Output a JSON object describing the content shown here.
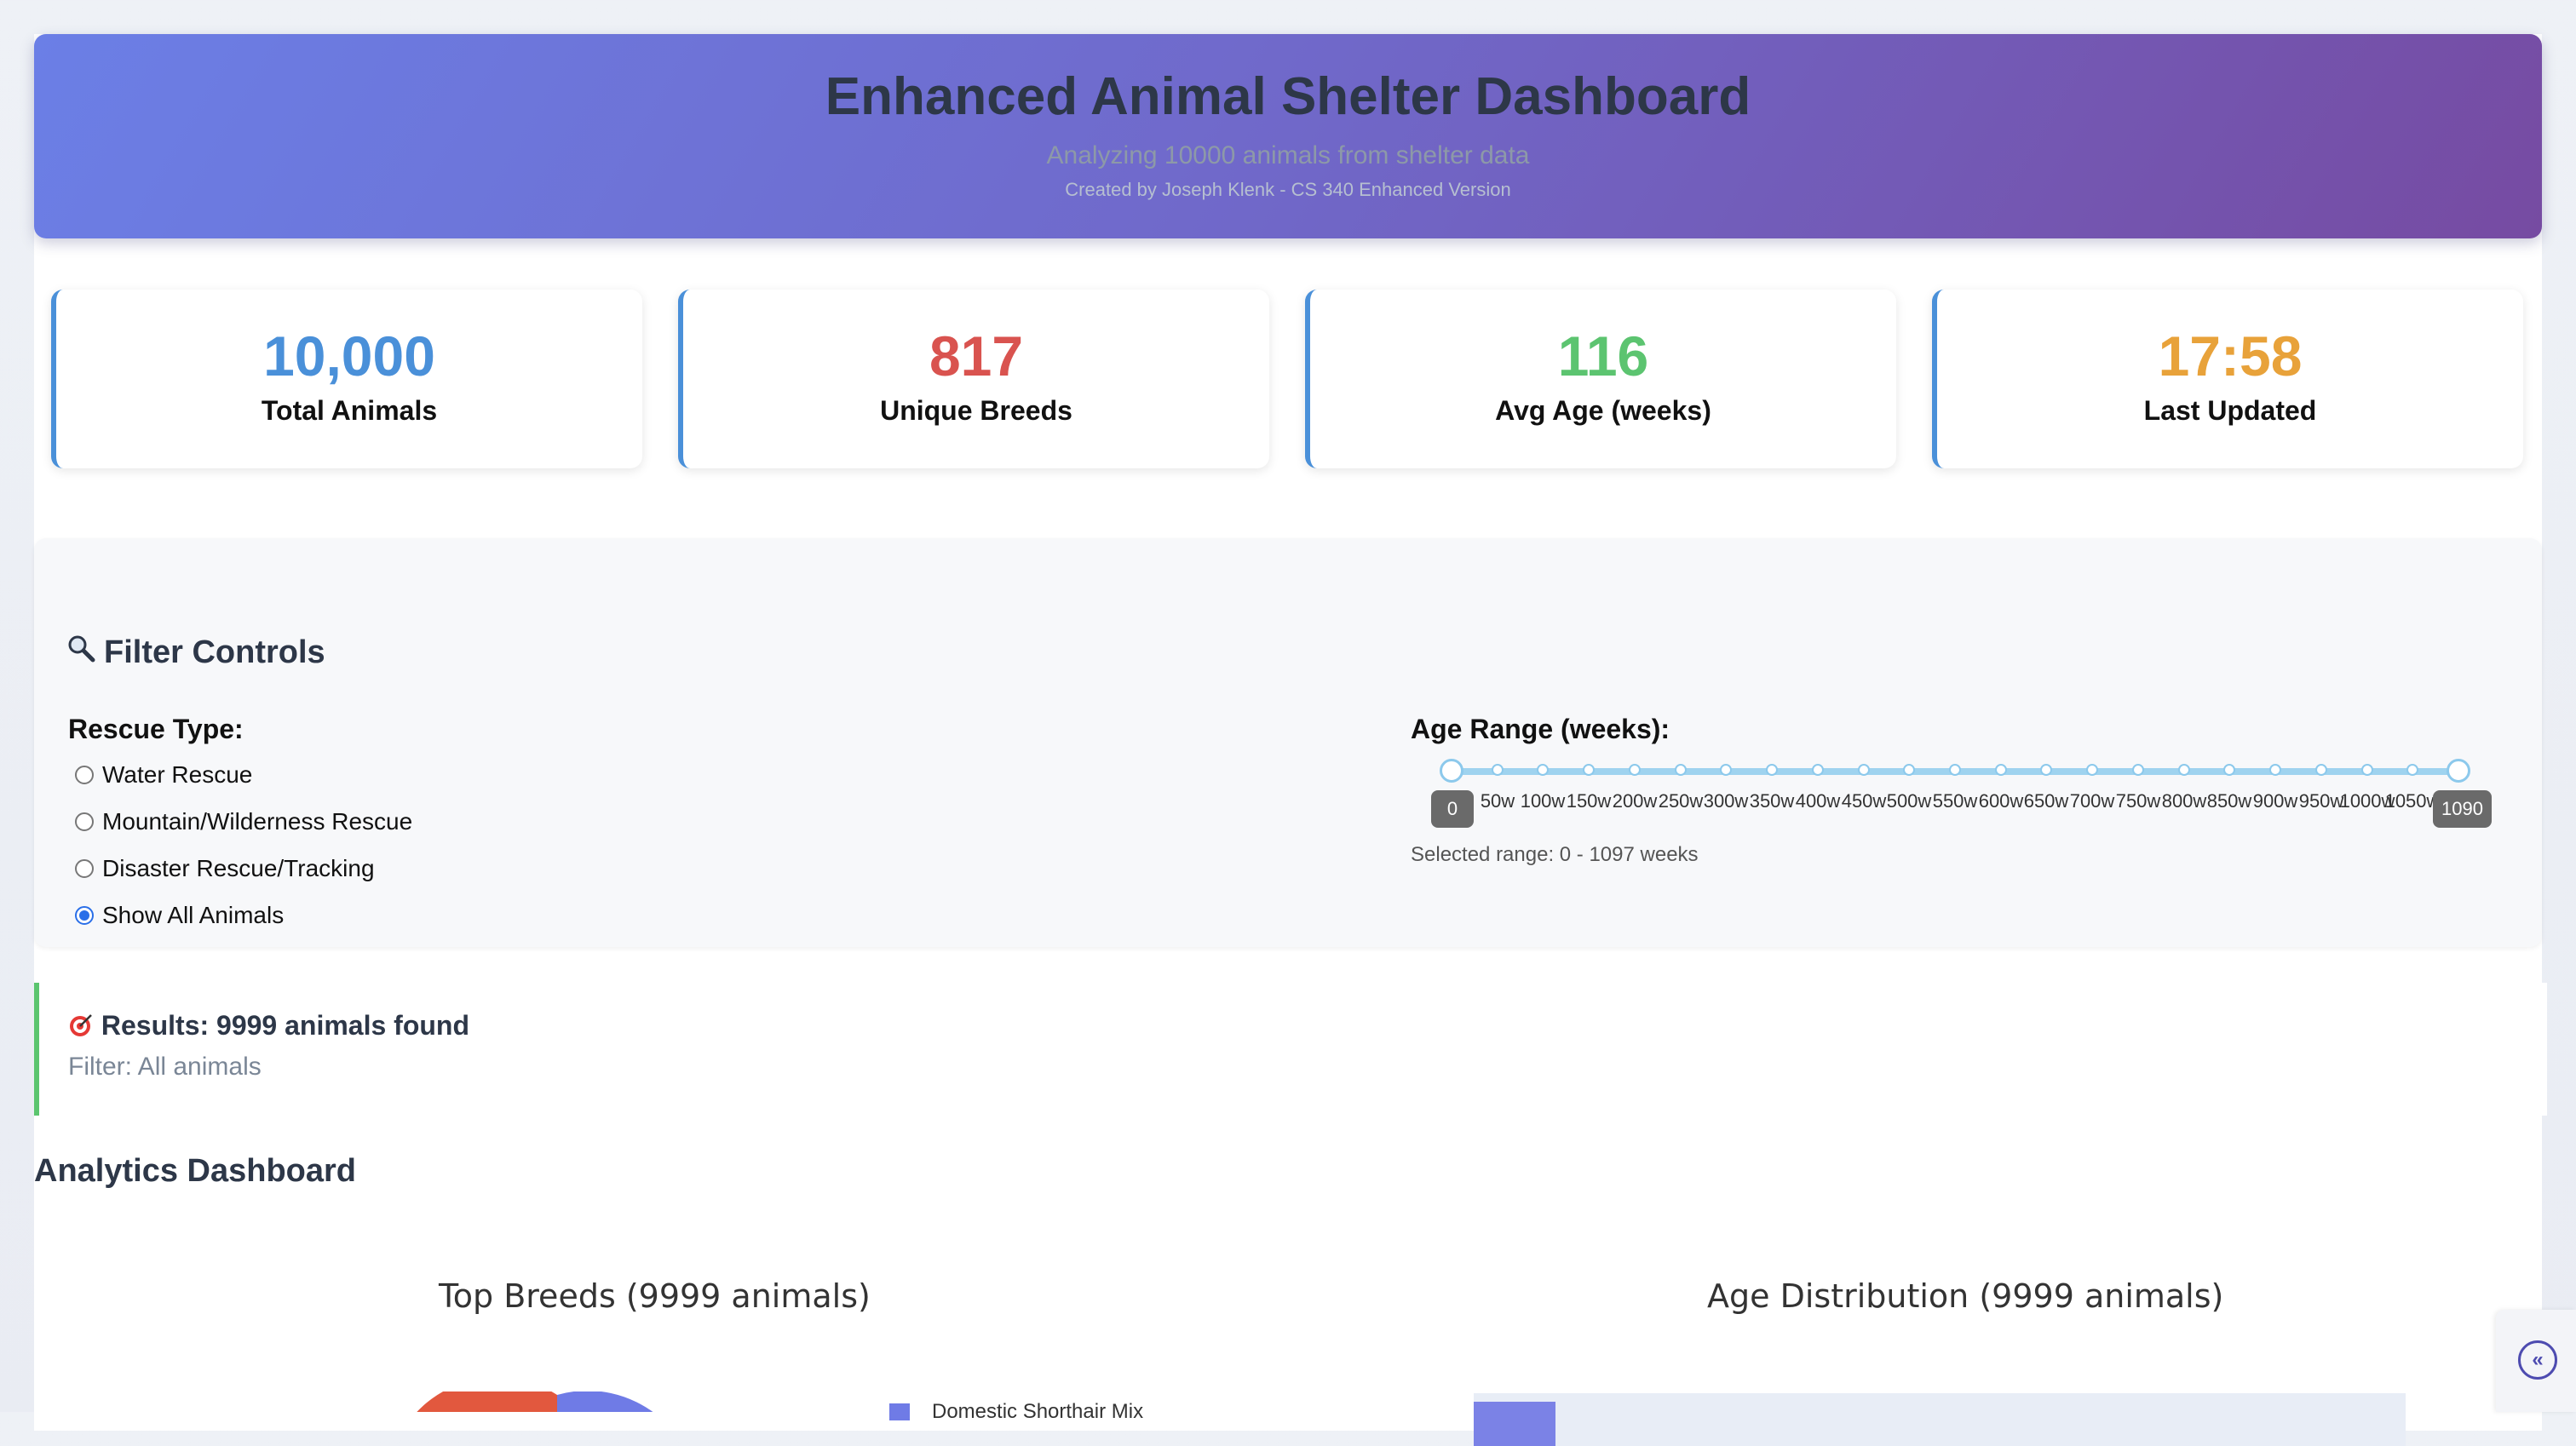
{
  "header": {
    "title": "Enhanced Animal Shelter Dashboard",
    "subtitle": "Analyzing 10000 animals from shelter data",
    "credit": "Created by Joseph Klenk - CS 340 Enhanced Version",
    "gradient_start": "#6b7fe6",
    "gradient_end": "#764ba2"
  },
  "stats": [
    {
      "value": "10,000",
      "label": "Total Animals",
      "color": "#4a90d9"
    },
    {
      "value": "817",
      "label": "Unique Breeds",
      "color": "#d9534f"
    },
    {
      "value": "116",
      "label": "Avg Age (weeks)",
      "color": "#5cc470"
    },
    {
      "value": "17:58",
      "label": "Last Updated",
      "color": "#e8a23a"
    }
  ],
  "filters": {
    "title": "Filter Controls",
    "title_icon": "search-icon",
    "rescue_type_label": "Rescue Type:",
    "options": [
      {
        "label": "Water Rescue",
        "checked": false
      },
      {
        "label": "Mountain/Wilderness Rescue",
        "checked": false
      },
      {
        "label": "Disaster Rescue/Tracking",
        "checked": false
      },
      {
        "label": "Show All Animals",
        "checked": true
      }
    ],
    "age_range_label": "Age Range (weeks):",
    "slider": {
      "min_value": "0",
      "max_value": "1090",
      "ticks": [
        "50w",
        "100w",
        "150w",
        "200w",
        "250w",
        "300w",
        "350w",
        "400w",
        "450w",
        "500w",
        "550w",
        "600w",
        "650w",
        "700w",
        "750w",
        "800w",
        "850w",
        "900w",
        "950w",
        "1000w",
        "1050w"
      ]
    },
    "selected_range": "Selected range: 0 - 1097 weeks"
  },
  "results": {
    "icon": "target-icon",
    "title": "Results: 9999 animals found",
    "filter_text": "Filter: All animals"
  },
  "analytics": {
    "heading": "Analytics Dashboard",
    "breeds_chart_title": "Top Breeds (9999 animals)",
    "breeds_legend_first": "Domestic Shorthair Mix",
    "age_chart_title": "Age Distribution (9999 animals)"
  },
  "side_toggle": {
    "icon": "chevrons-left-icon"
  }
}
